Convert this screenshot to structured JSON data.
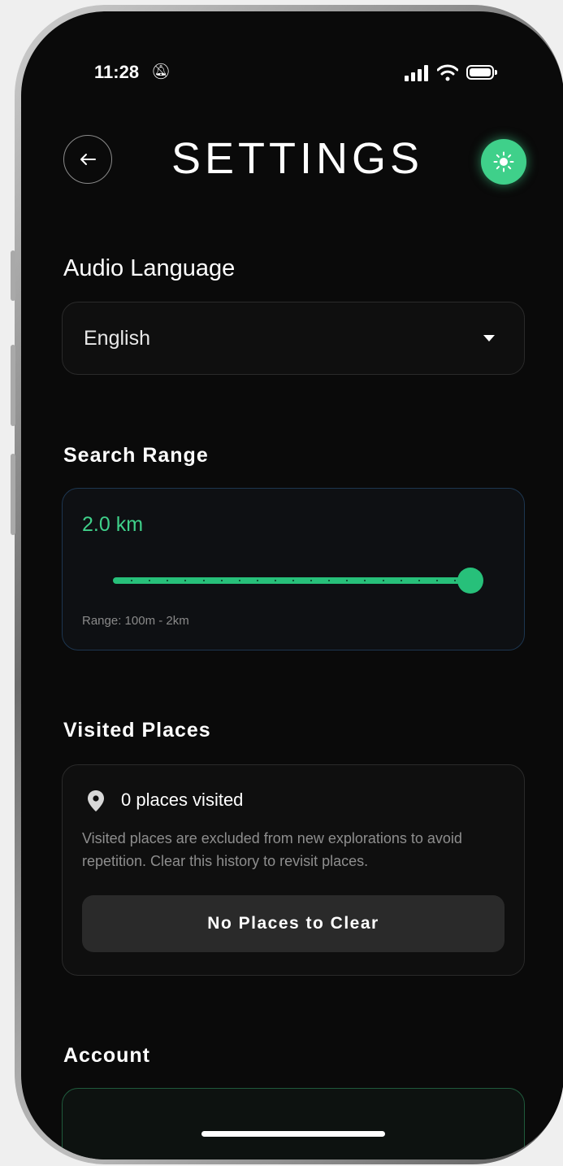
{
  "status_bar": {
    "time": "11:28",
    "icons": [
      "bell-slash-icon",
      "signal-icon",
      "wifi-icon",
      "battery-icon"
    ]
  },
  "header": {
    "title": "SETTINGS",
    "back_icon": "arrow-left-icon",
    "theme_icon": "sun-icon"
  },
  "audio_language": {
    "title": "Audio Language",
    "selected": "English"
  },
  "search_range": {
    "title": "Search Range",
    "value": "2.0 km",
    "range_hint": "Range: 100m - 2km",
    "slider_fraction": 1.0
  },
  "visited_places": {
    "title": "Visited Places",
    "count_label": "0 places visited",
    "description": "Visited places are excluded from new explorations to avoid repetition. Clear this history to revisit places.",
    "clear_button": "No Places to Clear"
  },
  "account": {
    "title": "Account"
  },
  "colors": {
    "accent": "#3fd08a",
    "background": "#0a0a0a",
    "card": "#0f0f0f"
  }
}
